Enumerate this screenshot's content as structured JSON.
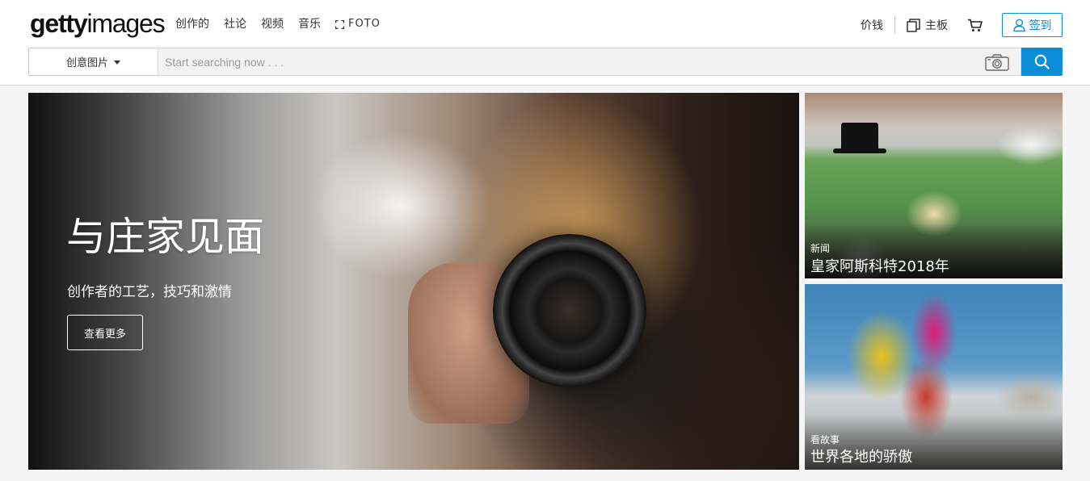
{
  "logo": {
    "bold": "getty",
    "light": "images"
  },
  "nav": {
    "items": [
      "创作的",
      "社论",
      "视频",
      "音乐"
    ],
    "foto_label": "FOTO",
    "foto_icon": "frame-corners-icon"
  },
  "right_nav": {
    "pricing": "价钱",
    "board": "主板",
    "board_icon": "boards-icon",
    "cart_icon": "cart-icon",
    "signin": "签到",
    "signin_icon": "user-icon"
  },
  "search": {
    "type_label": "创意图片",
    "placeholder": "Start searching now . . .",
    "value": "",
    "camera_icon": "camera-icon",
    "button_icon": "search-icon"
  },
  "hero": {
    "title": "与庄家见面",
    "subtitle": "创作者的工艺，技巧和激情",
    "button": "查看更多"
  },
  "cards": [
    {
      "kicker": "新闻",
      "title": "皇家阿斯科特2018年"
    },
    {
      "kicker": "看故事",
      "title": "世界各地的骄傲"
    }
  ],
  "colors": {
    "accent": "#0a8ed9"
  }
}
